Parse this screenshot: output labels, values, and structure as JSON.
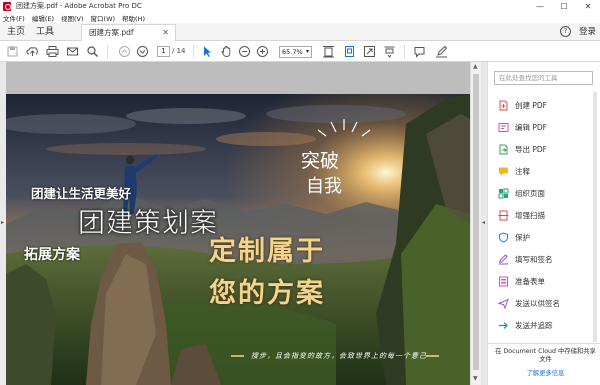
{
  "window": {
    "title": "团建方案.pdf - Adobe Acrobat Pro DC",
    "minimize": "—",
    "maximize": "☐",
    "close": "✕"
  },
  "menu": {
    "items": [
      "文件(F)",
      "编辑(E)",
      "视图(V)",
      "窗口(W)",
      "帮助(H)"
    ]
  },
  "tabs": {
    "home": "主页",
    "tools": "工具",
    "document": "团建方案.pdf",
    "help": "?",
    "signin": "登录"
  },
  "toolbar": {
    "page_current": "1",
    "page_total": "/ 14",
    "zoom": "65.7%"
  },
  "document": {
    "line1": "团建让生活更美好",
    "line2": "团建策划案",
    "line3": "拓展方案",
    "line4": "定制属于",
    "line5": "您的方案",
    "line6": "突破",
    "line7": "自我",
    "line8": "搜步，且会指变的故方，会致世界上的每一个意己"
  },
  "tools_panel": {
    "search_placeholder": "在此处查找您的工具",
    "items": [
      {
        "label": "创建 PDF",
        "icon": "create-pdf-icon",
        "color": "#e34850"
      },
      {
        "label": "编辑 PDF",
        "icon": "edit-pdf-icon",
        "color": "#d94fc2"
      },
      {
        "label": "导出 PDF",
        "icon": "export-pdf-icon",
        "color": "#3aa352"
      },
      {
        "label": "注释",
        "icon": "comment-icon",
        "color": "#f5b71a"
      },
      {
        "label": "组织页面",
        "icon": "organize-pages-icon",
        "color": "#2d9d78"
      },
      {
        "label": "增强扫描",
        "icon": "enhance-scan-icon",
        "color": "#e34850"
      },
      {
        "label": "保护",
        "icon": "protect-icon",
        "color": "#2680eb"
      },
      {
        "label": "填写和签名",
        "icon": "fill-sign-icon",
        "color": "#9256d9"
      },
      {
        "label": "准备表单",
        "icon": "prepare-form-icon",
        "color": "#d94fc2"
      },
      {
        "label": "发送以供签名",
        "icon": "send-for-signature-icon",
        "color": "#9256d9"
      },
      {
        "label": "发送并追踪",
        "icon": "send-track-icon",
        "color": "#2680eb"
      }
    ],
    "cloud_text": "在 Document Cloud 中存储和共享文件",
    "learn_more": "了解更多信息"
  }
}
